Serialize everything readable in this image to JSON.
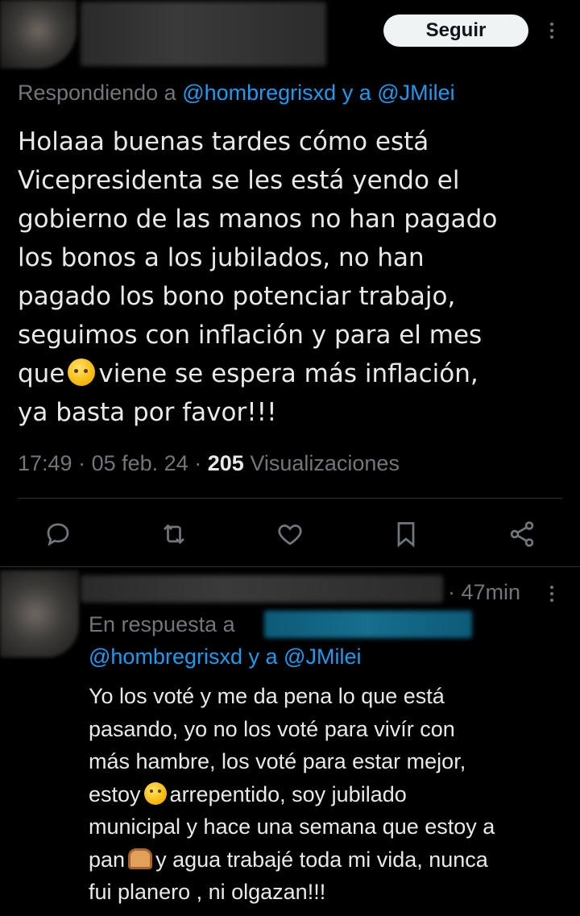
{
  "header": {
    "follow_label": "Seguir"
  },
  "tweet": {
    "reply_prefix": "Respondiendo a",
    "reply_user1": "@hombregrisxd",
    "reply_conj": "y a",
    "reply_user2": "@JMilei",
    "text_lines": [
      "Holaaa buenas tardes cómo está",
      "Vicepresidenta se les está yendo el",
      "gobierno de las manos no han pagado",
      "los bonos a los jubilados,  no han",
      "pagado los bono potenciar trabajo,",
      "seguimos con inflación y para el mes",
      "que",
      "viene se espera más inflación,",
      "ya basta por favor!!!"
    ],
    "emoji_thinking": "thinking-face-emoji",
    "time": "17:49",
    "date": "05 feb. 24",
    "views_count": "205",
    "views_label": "Visualizaciones",
    "separator": "·"
  },
  "actions": {
    "icons": [
      "reply-icon",
      "retweet-icon",
      "like-icon",
      "bookmark-icon",
      "share-icon"
    ]
  },
  "reply": {
    "time_ago": "· 47min",
    "resp_prefix": "En respuesta a",
    "resp_user1": "@hombregrisxd",
    "resp_conj": "y a",
    "resp_user2": "@JMilei",
    "text_lines": [
      "Yo los voté y me da pena lo que está",
      "pasando,  yo no los voté para vivír con",
      "más hambre,  los voté para estar mejor,",
      "estoy",
      "arrepentido,  soy jubilado",
      "municipal y hace una semana que estoy a",
      "pan",
      "y agua trabajé toda mi vida,  nunca",
      "fui planero , ni olgazan!!!"
    ]
  },
  "colors": {
    "background": "#000000",
    "text": "#e7e9ea",
    "secondary": "#71767b",
    "link": "#1d9bf0",
    "divider": "#2f3336"
  }
}
